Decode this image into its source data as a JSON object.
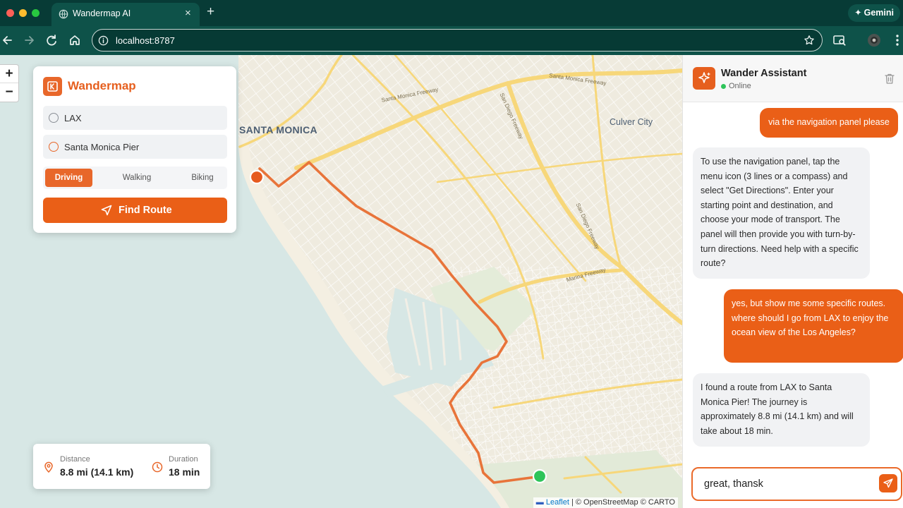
{
  "browser": {
    "tab_title": "Wandermap AI",
    "tab_close": "×",
    "new_tab": "+",
    "url": "localhost:8787",
    "gemini_label": "Gemini"
  },
  "map": {
    "zoom_in": "+",
    "zoom_out": "−",
    "labels": {
      "santa_monica": "SANTA MONICA",
      "culver_city": "Culver City",
      "sm_freeway_1": "Santa Monica Freeway",
      "sm_freeway_2": "Santa Monica Freeway",
      "sd_freeway_1": "San Diego Freeway",
      "sd_freeway_2": "San Diego Freeway",
      "marina_freeway": "Marina Freeway"
    },
    "attribution": {
      "leaflet": "Leaflet",
      "rest": "| © OpenStreetMap © CARTO"
    }
  },
  "planner": {
    "brand": "Wandermap",
    "start": "LAX",
    "destination": "Santa Monica Pier",
    "modes": [
      "Driving",
      "Walking",
      "Biking"
    ],
    "selected_mode": "Driving",
    "find_label": "Find Route"
  },
  "stats": {
    "distance_label": "Distance",
    "distance_value": "8.8 mi (14.1 km)",
    "duration_label": "Duration",
    "duration_value": "18 min"
  },
  "chat": {
    "name": "Wander Assistant",
    "status": "Online",
    "messages": [
      {
        "role": "user",
        "text": "via the navigation panel please"
      },
      {
        "role": "assistant",
        "text": "To use the navigation panel, tap the menu icon (3 lines or a compass) and select \"Get Directions\". Enter your starting point and destination, and choose your mode of transport. The panel will then provide you with turn-by-turn directions. Need help with a specific route?"
      },
      {
        "role": "user",
        "text": "yes, but show me some specific routes. where should I go from LAX to enjoy the ocean view of the Los Angeles?"
      },
      {
        "role": "assistant",
        "text": "I found a route from LAX to Santa Monica Pier! The journey is approximately 8.8 mi (14.1 km) and will take about 18 min."
      }
    ],
    "input_value": "great, thansk"
  },
  "colors": {
    "accent": "#ea5f17",
    "route": "#e8743a",
    "start_marker": "#2ec45a",
    "end_marker": "#e65a1e",
    "water": "#d7e7e5",
    "land": "#f2efe6",
    "chrome": "#0e5249"
  },
  "icons": [
    "globe-icon",
    "back-icon",
    "forward-icon",
    "reload-icon",
    "home-icon",
    "info-icon",
    "star-icon",
    "cast-icon",
    "profile-icon",
    "more-icon",
    "logo-icon",
    "navigation-arrow-icon",
    "pin-icon",
    "clock-icon",
    "sparkle-icon",
    "trash-icon",
    "send-icon"
  ]
}
